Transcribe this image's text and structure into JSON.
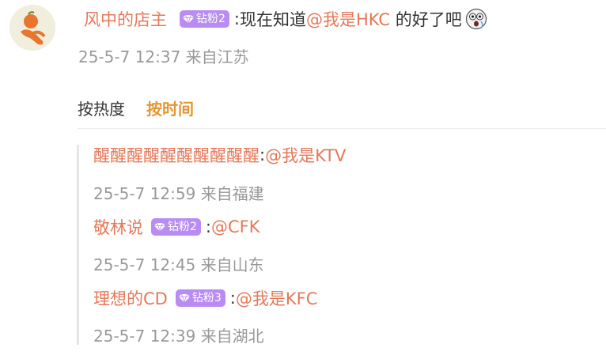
{
  "comment": {
    "user": "风中的店主",
    "badge": "钻粉2",
    "separator": ":",
    "text_before": "现在知道",
    "mention": "@我是HKC",
    "text_after": " 的好了吧",
    "emoji_icon": "shocked-face-icon",
    "meta": "25-5-7 12:37 来自江苏"
  },
  "sort_tabs": [
    {
      "label": "按热度",
      "active": false
    },
    {
      "label": "按时间",
      "active": true
    }
  ],
  "replies": [
    {
      "user": "醒醒醒醒醒醒醒醒醒醒",
      "badge": "",
      "separator": ":",
      "mention": "@我是KTV",
      "meta": "25-5-7 12:59 来自福建"
    },
    {
      "user": "敬林说",
      "badge": "钻粉2",
      "separator": ":",
      "mention": "@CFK",
      "meta": "25-5-7 12:45 来自山东"
    },
    {
      "user": "理想的CD",
      "badge": "钻粉3",
      "separator": ":",
      "mention": "@我是KFC",
      "meta": "25-5-7 12:39 来自湖北"
    }
  ],
  "colors": {
    "username": "#e5785a",
    "active_tab": "#e59532",
    "badge_bg": "#b98cf4",
    "meta": "#999999"
  }
}
